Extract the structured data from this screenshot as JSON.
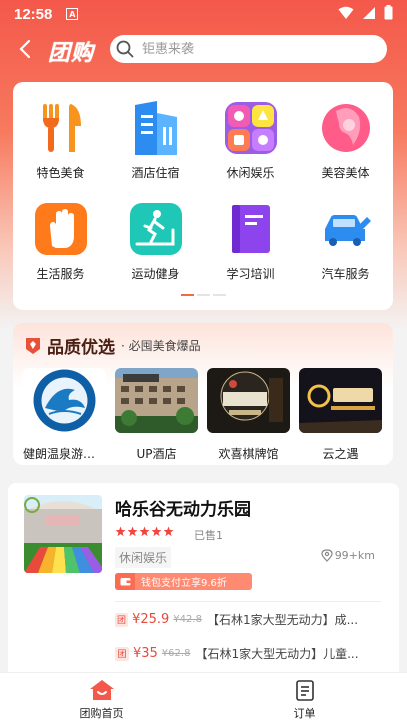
{
  "status_bar": {
    "time": "12:58",
    "notification_badge": "A"
  },
  "header": {
    "logo": "团购",
    "search_placeholder": "钜惠来袭"
  },
  "categories": [
    {
      "label": "特色美食",
      "icon": "fork-knife-icon"
    },
    {
      "label": "酒店住宿",
      "icon": "hotel-icon"
    },
    {
      "label": "休闲娱乐",
      "icon": "entertainment-icon"
    },
    {
      "label": "美容美体",
      "icon": "beauty-icon"
    },
    {
      "label": "生活服务",
      "icon": "hand-icon"
    },
    {
      "label": "运动健身",
      "icon": "treadmill-icon"
    },
    {
      "label": "学习培训",
      "icon": "book-icon"
    },
    {
      "label": "汽车服务",
      "icon": "car-icon"
    }
  ],
  "quality_picks": {
    "title": "品质优选",
    "subtitle": "· 必囤美食爆品",
    "items": [
      {
        "name": "健朗温泉游泳..."
      },
      {
        "name": "UP酒店"
      },
      {
        "name": "欢喜棋牌馆"
      },
      {
        "name": "云之遇"
      }
    ]
  },
  "deal": {
    "title": "哈乐谷无动力乐园",
    "rating_stars": 5,
    "sold": "已售1",
    "tag": "休闲娱乐",
    "distance": "99+km",
    "promo": "钱包支付立享9.6折",
    "offers": [
      {
        "badge": "团",
        "price": "¥25.9",
        "original": "¥42.8",
        "desc": "【石林1家大型无动力】成..."
      },
      {
        "badge": "团",
        "price": "¥35",
        "original": "¥62.8",
        "desc": "【石林1家大型无动力】儿童..."
      }
    ]
  },
  "bottom_nav": [
    {
      "label": "团购首页",
      "active": true
    },
    {
      "label": "订单",
      "active": false
    }
  ],
  "colors": {
    "accent": "#f4584a",
    "price": "#e84a3c"
  }
}
